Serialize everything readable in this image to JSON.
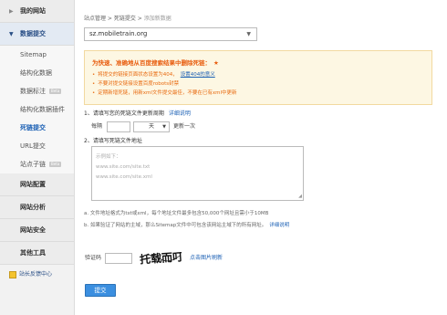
{
  "sidebar": {
    "my_site": "我的网站",
    "data_submit": "数据提交",
    "sub_items": [
      {
        "label": "Sitemap",
        "badge": ""
      },
      {
        "label": "结构化数据",
        "badge": ""
      },
      {
        "label": "数据标注",
        "badge": "Beta"
      },
      {
        "label": "结构化数据插件",
        "badge": ""
      },
      {
        "label": "死链提交",
        "badge": ""
      },
      {
        "label": "URL提交",
        "badge": ""
      },
      {
        "label": "站点子链",
        "badge": "Beta"
      }
    ],
    "sections": [
      "网站配置",
      "网站分析",
      "网站安全",
      "其他工具"
    ],
    "feedback": "站长反馈中心"
  },
  "breadcrumb": {
    "root": "站点管理",
    "sep1": " > ",
    "parent": "死链提交",
    "sep2": " > ",
    "current": "添加新数据"
  },
  "site_select": {
    "value": "sz.mobiletrain.org"
  },
  "notice": {
    "title": "为快速、准确地从百度搜索结果中删除死链：",
    "star": "★",
    "items": [
      {
        "text": "将提交的链接页面状态设置为404，",
        "link": "设置404的意义"
      },
      {
        "text": "不要对提交链接设置百度robots封禁",
        "link": ""
      },
      {
        "text": "定期新增死链，用新xml文件提交最佳，不要在已有xml中更新",
        "link": ""
      }
    ]
  },
  "step1": {
    "label": "1、请填写您的死链文件更新周期",
    "help": "详细说明"
  },
  "interval": {
    "prefix": "每隔",
    "unit": "天",
    "suffix": "更新一次"
  },
  "step2": {
    "label": "2、请填写死链文件地址"
  },
  "textarea_placeholder": [
    "示例如下：",
    "www.site.com/site.txt",
    "www.site.com/site.xml"
  ],
  "notes": {
    "a": "a. 文件地址格式为txt或xml，每个地址文件最多包含50,000个网址且需小于10MB",
    "b": "b. 如果验证了网站的主域，那么Sitemap文件中可包含该网站主域下的所有网址。",
    "b_help": "详细说明"
  },
  "captcha": {
    "label": "验证码",
    "text": "托载而叮",
    "refresh": "点击图片刷新"
  },
  "submit": {
    "label": "提交"
  }
}
